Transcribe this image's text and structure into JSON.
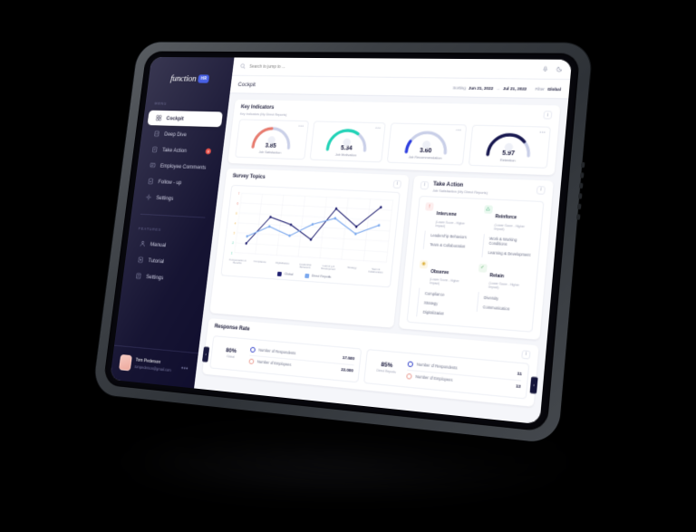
{
  "app": {
    "logo_text": "function",
    "logo_badge": "HR"
  },
  "sidebar": {
    "menu_label": "MENU",
    "features_label": "FEATURES",
    "menu_items": [
      {
        "label": "Cockpit",
        "icon": "grid-icon",
        "active": true,
        "badge": ""
      },
      {
        "label": "Deep Dive",
        "icon": "chart-icon",
        "active": false,
        "badge": ""
      },
      {
        "label": "Take Action",
        "icon": "target-icon",
        "active": false,
        "badge": "3"
      },
      {
        "label": "Employee Comments",
        "icon": "comment-icon",
        "active": false,
        "badge": ""
      },
      {
        "label": "Follow - up",
        "icon": "refresh-icon",
        "active": false,
        "badge": ""
      },
      {
        "label": "Settings",
        "icon": "gear-icon",
        "active": false,
        "badge": ""
      }
    ],
    "feature_items": [
      {
        "label": "Manual",
        "icon": "book-icon"
      },
      {
        "label": "Tutorial",
        "icon": "play-icon"
      },
      {
        "label": "Settings",
        "icon": "sliders-icon"
      }
    ],
    "user": {
      "name": "Tom Pederson",
      "email": "tompederson@gmail.com",
      "more": "•••"
    }
  },
  "topbar": {
    "search_placeholder": "Search to jump to ...",
    "search_value": "",
    "icons": [
      "microphone-icon",
      "moon-icon"
    ]
  },
  "pagebar": {
    "title": "Cockpit",
    "sorting_label": "Sorting",
    "date_from": "Jun 21, 2022",
    "date_arrow": "→",
    "date_to": "Jul 21, 2022",
    "filter_label": "Filter",
    "filter_value": "Global"
  },
  "key_indicators": {
    "title": "Key Indicators",
    "subtitle": "Key Indicators (My Direct Reports)",
    "info_icon": "info-icon",
    "menu_glyph": "•••",
    "cards": [
      {
        "value": "3.85",
        "label": "Job Satisfaction",
        "pct": 48,
        "color": "#e8786b"
      },
      {
        "value": "5.34",
        "label": "Job Motivation",
        "pct": 68,
        "color": "#1fd3b6"
      },
      {
        "value": "3.60",
        "label": "Job Recommendation",
        "pct": 18,
        "color": "#2f3fe0"
      },
      {
        "value": "5.97",
        "label": "Retention",
        "pct": 76,
        "color": "#17174f"
      }
    ]
  },
  "survey_topics": {
    "title": "Survey Topics"
  },
  "chart_data": {
    "type": "line",
    "title": "Survey Topics",
    "xlabel": "",
    "ylabel": "",
    "ylim": [
      1,
      7
    ],
    "yticks": [
      1,
      2,
      3,
      4,
      5,
      6,
      7
    ],
    "ytick_colors": [
      "#3bc9a0",
      "#3bc9a0",
      "#f0b441",
      "#f0b441",
      "#f0b441",
      "#e8786b",
      "#e8786b"
    ],
    "grid": true,
    "legend_position": "bottom",
    "categories": [
      "Compensation & Benefits",
      "Compliance",
      "Digitalisation",
      "Leadership Behaviors",
      "Learning & Development",
      "Strategy",
      "Team & Collaboration"
    ],
    "series": [
      {
        "name": "Global",
        "color": "#1b1b6e",
        "values": [
          2.0,
          4.75,
          4.1,
          2.75,
          5.9,
          4.25,
          6.25
        ]
      },
      {
        "name": "Direct Reports",
        "color": "#7aa8ee",
        "values": [
          2.7,
          3.8,
          3.0,
          4.25,
          4.95,
          3.55,
          4.5
        ]
      }
    ]
  },
  "take_action": {
    "title": "Take Action",
    "subtitle": "Job Satisfaction (My Direct Reports)",
    "info_icon": "info-icon",
    "left_icon": "info-icon",
    "groups": [
      {
        "name": "Intervene",
        "note": "(Lower Score - Higher Impact)",
        "icon": "alert-icon",
        "icon_bg": "#fdeeee",
        "icon_color": "#e06a63",
        "items": [
          "Leadership Behaviors",
          "Team & Collaboration"
        ]
      },
      {
        "name": "Reinforce",
        "note": "(Lower Score - Higher Impact)",
        "icon": "recycle-icon",
        "icon_bg": "#e9f8ef",
        "icon_color": "#38ac6e",
        "items": [
          "Work & Working Conditions",
          "Learning & Development"
        ]
      },
      {
        "name": "Observe",
        "note": "(Lower Score - Higher Impact)",
        "icon": "eye-icon",
        "icon_bg": "#fdf7e6",
        "icon_color": "#d8a726",
        "items": [
          "Compliance",
          "Strategy",
          "Digitalization"
        ]
      },
      {
        "name": "Retain",
        "note": "(Lower Score - Higher Impact)",
        "icon": "check-icon",
        "icon_bg": "#eef8ef",
        "icon_color": "#4aa85c",
        "items": [
          "Diversity",
          "Communication"
        ]
      }
    ]
  },
  "response_rate": {
    "title": "Response Rate",
    "info_icon": "info-icon",
    "prev_glyph": "‹",
    "next_glyph": "›",
    "cards": [
      {
        "pct": "80%",
        "scope": "Global",
        "rows": [
          {
            "label": "Number of Respondents",
            "value": "17.500",
            "ring": "blue"
          },
          {
            "label": "Number of Employees",
            "value": "22.000",
            "ring": "red"
          }
        ]
      },
      {
        "pct": "85%",
        "scope": "Direct Reports",
        "rows": [
          {
            "label": "Number of Respondents",
            "value": "11",
            "ring": "blue"
          },
          {
            "label": "Number of Employees",
            "value": "13",
            "ring": "red"
          }
        ]
      }
    ]
  },
  "colors": {
    "sidebar_bg": "#0d0b2b",
    "accent": "#2f4be0",
    "page_bg": "#f5f6fa",
    "danger": "#e8453c",
    "series_global": "#1b1b6e",
    "series_direct": "#7aa8ee"
  }
}
